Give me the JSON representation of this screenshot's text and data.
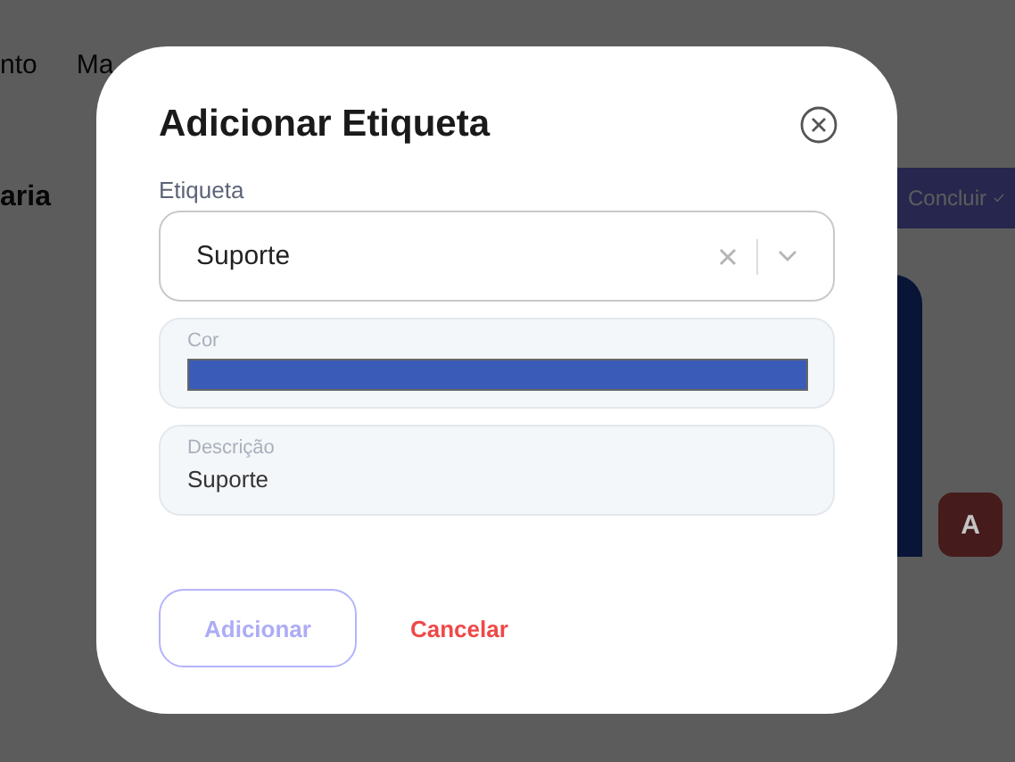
{
  "background": {
    "nav_items": [
      "nto",
      "Ma"
    ],
    "page_title": "aria",
    "primary_button": {
      "label": "Concluir"
    },
    "avatar": "A"
  },
  "dialog": {
    "title": "Adicionar Etiqueta",
    "fields": [
      {
        "kind": "select",
        "label": "Etiqueta",
        "value": "Suporte"
      },
      {
        "kind": "color",
        "label": "Cor",
        "color": "#3a5bb8"
      },
      {
        "kind": "text",
        "label": "Descrição",
        "value": "Suporte"
      }
    ],
    "buttons": [
      {
        "kind": "outline",
        "label": "Adicionar",
        "disabled": true
      },
      {
        "kind": "link",
        "label": "Cancelar",
        "disabled": false
      }
    ]
  }
}
